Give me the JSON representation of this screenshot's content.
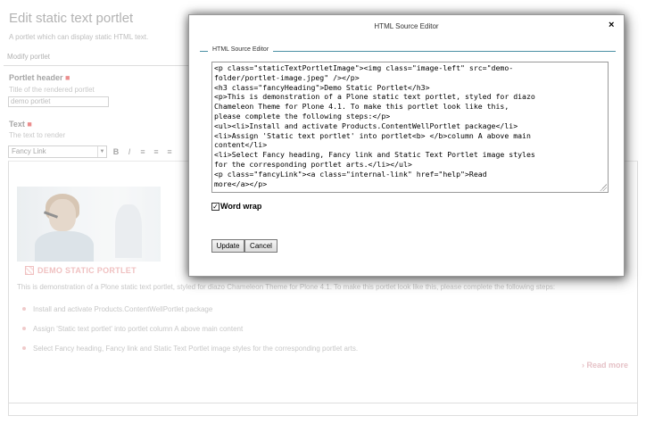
{
  "page": {
    "title": "Edit static text portlet",
    "description": "A portlet which can display static HTML text.",
    "tab_label": "Modify portlet"
  },
  "fields": {
    "header": {
      "label": "Portlet header",
      "help": "Title of the rendered portlet",
      "value": "demo portlet"
    },
    "text": {
      "label": "Text",
      "help": "The text to render"
    }
  },
  "toolbar": {
    "style_select_value": "Fancy Link",
    "bold_label": "B",
    "italic_label": "I"
  },
  "preview": {
    "heading": "DEMO STATIC PORTLET",
    "paragraph": "This is demonstration of a Plone static text portlet, styled for diazo Chameleon Theme for Plone 4.1. To make this portlet look like this, please complete the following steps:",
    "items": [
      "Install and activate Products.ContentWellPortlet package",
      "Assign 'Static text portlet' into portlet column A above main content",
      "Select Fancy heading, Fancy link and Static Text Portlet image styles for the corresponding portlet arts."
    ],
    "read_more": "Read more"
  },
  "dialog": {
    "title": "HTML Source Editor",
    "close_label": "×",
    "legend": "HTML Source Editor",
    "source_lines": [
      "<p class=\"staticTextPortletImage\"><img class=\"image-left\" src=\"demo-",
      "folder/portlet-image.jpeg\" /></p>",
      "<h3 class=\"fancyHeading\">Demo Static Portlet</h3>",
      "<p>This is demonstration of a Plone static text portlet, styled for diazo",
      "Chameleon Theme for Plone 4.1. To make this portlet look like this,",
      "please complete the following steps:</p>",
      "<ul><li>Install and activate Products.ContentWellPortlet package</li>",
      "<li>Assign 'Static text portlet' into portlet<b> </b>column A above main",
      "content</li>",
      "<li>Select Fancy heading, Fancy link and Static Text Portlet image styles",
      "for the corresponding portlet arts.</li></ul>",
      "<p class=\"fancyLink\"><a class=\"internal-link\" href=\"help\">Read",
      "more</a></p>"
    ],
    "word_wrap_label": "Word wrap",
    "word_wrap_checked": true,
    "update_label": "Update",
    "cancel_label": "Cancel"
  }
}
